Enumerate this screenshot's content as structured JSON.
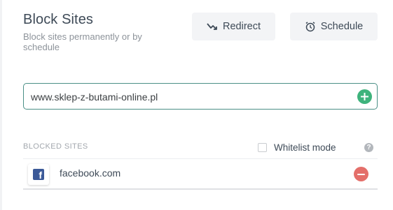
{
  "header": {
    "title": "Block Sites",
    "subtitle": "Block sites permanently or by schedule"
  },
  "toolbar": {
    "redirect_label": "Redirect",
    "schedule_label": "Schedule"
  },
  "url_input": {
    "value": "www.sklep-z-butami-online.pl"
  },
  "blocked_list": {
    "section_label": "BLOCKED SITES",
    "whitelist_label": "Whitelist mode",
    "whitelist_checked": false,
    "help_glyph": "?",
    "items": [
      {
        "site": "facebook.com",
        "icon": "facebook-icon",
        "favicon_letter": "f"
      }
    ]
  },
  "colors": {
    "accent_green": "#3eb37c",
    "remove_red": "#e46f6a",
    "input_border": "#4a8f86",
    "facebook_blue": "#3b5998"
  }
}
